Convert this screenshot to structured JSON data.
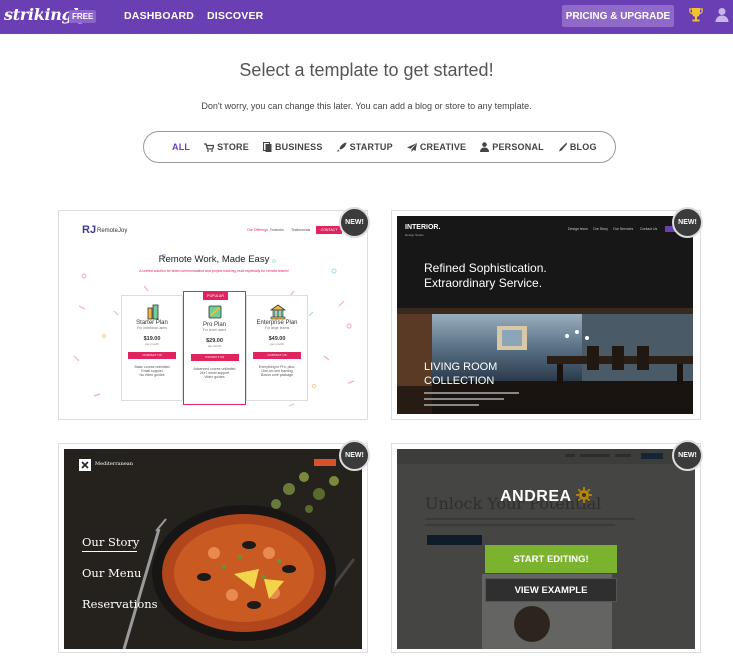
{
  "topbar": {
    "logo": "strikingly",
    "badge": "FREE",
    "nav": [
      "DASHBOARD",
      "DISCOVER"
    ],
    "pricing": "PRICING & UPGRADE",
    "icons": [
      "trophy-icon",
      "user-icon"
    ]
  },
  "heading": "Select a template to get started!",
  "subheading": "Don't worry, you can change this later. You can add a blog or store to any template.",
  "filters": [
    {
      "label": "ALL",
      "icon": ""
    },
    {
      "label": "STORE",
      "icon": "cart-icon"
    },
    {
      "label": "BUSINESS",
      "icon": "document-icon"
    },
    {
      "label": "STARTUP",
      "icon": "rocket-icon"
    },
    {
      "label": "CREATIVE",
      "icon": "paper-plane-icon"
    },
    {
      "label": "PERSONAL",
      "icon": "person-icon"
    },
    {
      "label": "BLOG",
      "icon": "pen-icon"
    }
  ],
  "new_badge": "NEW!",
  "templates": [
    {
      "brand": "RemoteJoy",
      "nav": [
        "Our Offerings",
        "Features",
        "Testimonials",
        "CONTACT"
      ],
      "headline": "Remote Work, Made Easy",
      "tagline": "A unified solution for team communication and project tracking, built especially for remote teams!",
      "popular": "POPULAR",
      "plans": [
        {
          "name": "Starter Plan",
          "for": "For individual users",
          "price": "$19.00",
          "per": "per month",
          "button": "CONTACT US",
          "features": [
            "Basic course unlimited",
            "Email support",
            "No video guides"
          ]
        },
        {
          "name": "Pro Plan",
          "for": "For team users",
          "price": "$29.00",
          "per": "per month",
          "button": "CONTACT US",
          "features": [
            "Advanced course unlimited",
            "24x7 email support",
            "Video guides"
          ]
        },
        {
          "name": "Enterprise Plan",
          "for": "For large teams",
          "price": "$49.00",
          "per": "per month",
          "button": "CONTACT US",
          "features": [
            "Everything in Pro, plus:",
            "One-on-one training",
            "Bonus core package"
          ]
        }
      ]
    },
    {
      "brand": "INTERIOR.",
      "brand_sub": "Design Studio",
      "nav": [
        "Design team",
        "Our Story",
        "Our Services",
        "Contact Us"
      ],
      "headline": "Refined Sophistication.",
      "headline2": "Extraordinary Service.",
      "collection": "LIVING ROOM",
      "collection2": "COLLECTION"
    },
    {
      "brand": "Mediterranean",
      "links": [
        "Our Story",
        "Our Menu",
        "Reservations"
      ]
    },
    {
      "name": "ANDREA",
      "headline": "Unlock Your Potential",
      "start": "START EDITING!",
      "view": "VIEW EXAMPLE"
    }
  ]
}
